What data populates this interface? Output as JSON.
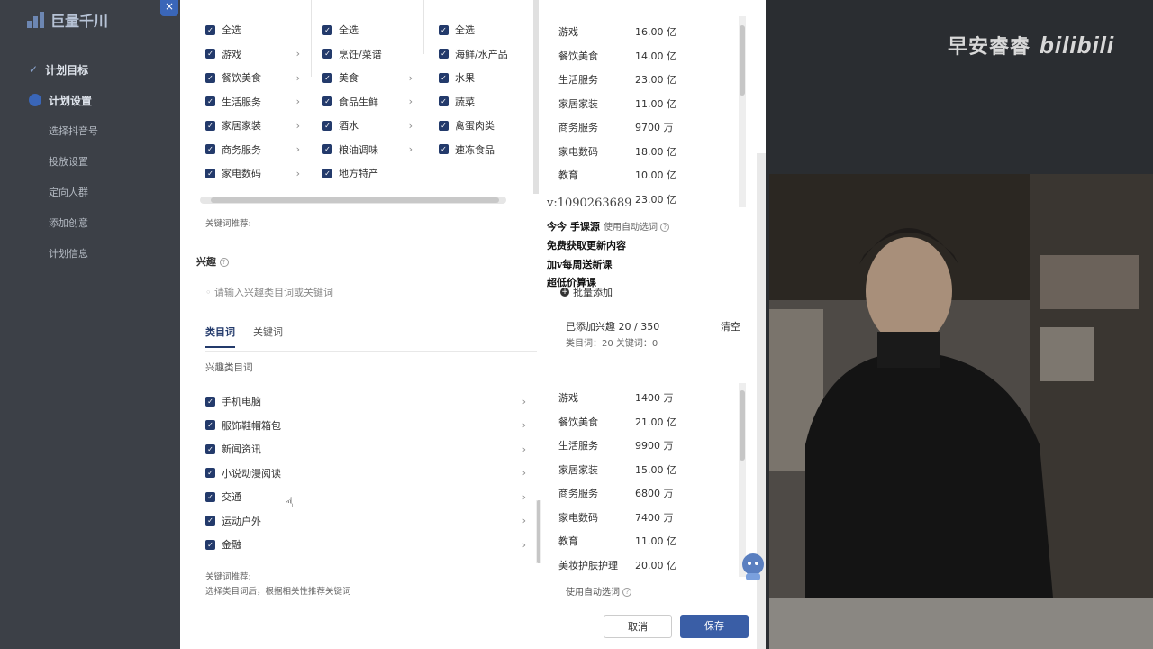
{
  "app": {
    "brand": "巨量千川",
    "nav": [
      {
        "label": "计划目标",
        "kind": "main-check"
      },
      {
        "label": "计划设置",
        "kind": "main-dot"
      },
      {
        "label": "选择抖音号",
        "kind": "sub"
      },
      {
        "label": "投放设置",
        "kind": "sub"
      },
      {
        "label": "定向人群",
        "kind": "sub"
      },
      {
        "label": "添加创意",
        "kind": "sub"
      },
      {
        "label": "计划信息",
        "kind": "sub"
      }
    ],
    "close": "×"
  },
  "behavior_columns": {
    "col1": [
      {
        "label": "全选",
        "chevron": false
      },
      {
        "label": "游戏",
        "chevron": true
      },
      {
        "label": "餐饮美食",
        "chevron": true
      },
      {
        "label": "生活服务",
        "chevron": true
      },
      {
        "label": "家居家装",
        "chevron": true
      },
      {
        "label": "商务服务",
        "chevron": true
      },
      {
        "label": "家电数码",
        "chevron": true
      }
    ],
    "col2": [
      {
        "label": "全选",
        "chevron": false
      },
      {
        "label": "烹饪/菜谱",
        "chevron": false
      },
      {
        "label": "美食",
        "chevron": true
      },
      {
        "label": "食品生鲜",
        "chevron": true
      },
      {
        "label": "酒水",
        "chevron": true
      },
      {
        "label": "粮油调味",
        "chevron": true
      },
      {
        "label": "地方特产",
        "chevron": false
      }
    ],
    "col3": [
      {
        "label": "全选",
        "chevron": false
      },
      {
        "label": "海鲜/水产品",
        "chevron": false
      },
      {
        "label": "水果",
        "chevron": false
      },
      {
        "label": "蔬菜",
        "chevron": false
      },
      {
        "label": "禽蛋肉类",
        "chevron": false
      },
      {
        "label": "速冻食品",
        "chevron": false
      }
    ],
    "keyword_hint_title": "关键词推荐:"
  },
  "behavior_selected": [
    {
      "name": "游戏",
      "value": "16.00 亿"
    },
    {
      "name": "餐饮美食",
      "value": "14.00 亿"
    },
    {
      "name": "生活服务",
      "value": "23.00 亿"
    },
    {
      "name": "家居家装",
      "value": "11.00 亿"
    },
    {
      "name": "商务服务",
      "value": "9700 万"
    },
    {
      "name": "家电数码",
      "value": "18.00 亿"
    },
    {
      "name": "教育",
      "value": "10.00 亿"
    },
    {
      "name": "",
      "value": "23.00 亿"
    }
  ],
  "overlay": {
    "contact": "v:1090263689",
    "lines": [
      "今今 手课源",
      "免费获取更新内容",
      "加v每周送新课",
      "超低价算课"
    ],
    "auto_word": "使用自动选词"
  },
  "interest": {
    "title": "兴趣",
    "placeholder": "请输入兴趣类目词或关键词",
    "tabs": [
      "类目词",
      "关键词"
    ],
    "section_label": "兴趣类目词",
    "items": [
      {
        "label": "手机电脑"
      },
      {
        "label": "服饰鞋帽箱包"
      },
      {
        "label": "新闻资讯"
      },
      {
        "label": "小说动漫阅读"
      },
      {
        "label": "交通"
      },
      {
        "label": "运动户外"
      },
      {
        "label": "金融"
      }
    ],
    "keyword_hint_title": "关键词推荐:",
    "keyword_hint_body": "选择类目词后，根据相关性推荐关键词",
    "batch_add": "批量添加",
    "added_summary": "已添加兴趣 20 / 350",
    "clear": "清空",
    "counts": "类目词：20    关键词：0",
    "selected": [
      {
        "name": "游戏",
        "value": "1400 万"
      },
      {
        "name": "餐饮美食",
        "value": "21.00 亿"
      },
      {
        "name": "生活服务",
        "value": "9900 万"
      },
      {
        "name": "家居家装",
        "value": "15.00 亿"
      },
      {
        "name": "商务服务",
        "value": "6800 万"
      },
      {
        "name": "家电数码",
        "value": "7400 万"
      },
      {
        "name": "教育",
        "value": "11.00 亿"
      },
      {
        "name": "美妆护肤护理",
        "value": "20.00 亿"
      }
    ],
    "auto_word": "使用自动选词"
  },
  "footer": {
    "cancel": "取消",
    "save": "保存"
  },
  "watermark": {
    "channel": "早安睿睿",
    "site": "bilibili"
  },
  "colors": {
    "accent": "#3a5ea6",
    "checkbox": "#233a6b"
  }
}
